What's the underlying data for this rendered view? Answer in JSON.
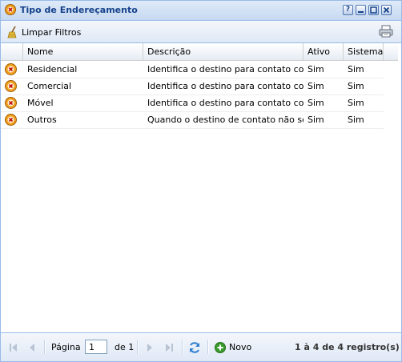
{
  "window": {
    "title": "Tipo de Endereçamento"
  },
  "toolbar": {
    "clear_filters_label": "Limpar Filtros"
  },
  "grid": {
    "columns": [
      "Nome",
      "Descrição",
      "Ativo",
      "Sistema"
    ],
    "rows": [
      {
        "nome": "Residencial",
        "descricao": "Identifica o destino para contato com...",
        "ativo": "Sim",
        "sistema": "Sim"
      },
      {
        "nome": "Comercial",
        "descricao": "Identifica o destino para contato com...",
        "ativo": "Sim",
        "sistema": "Sim"
      },
      {
        "nome": "Móvel",
        "descricao": "Identifica o destino para contato com...",
        "ativo": "Sim",
        "sistema": "Sim"
      },
      {
        "nome": "Outros",
        "descricao": "Quando o destino de contato não se ...",
        "ativo": "Sim",
        "sistema": "Sim"
      }
    ]
  },
  "pager": {
    "page_label": "Página",
    "page_value": "1",
    "of_label": "de 1",
    "new_label": "Novo",
    "summary": "1 à 4 de 4 registro(s)"
  },
  "colors": {
    "title_text": "#15428b",
    "border": "#99bbe8",
    "new_icon": "#3c9b2e"
  }
}
